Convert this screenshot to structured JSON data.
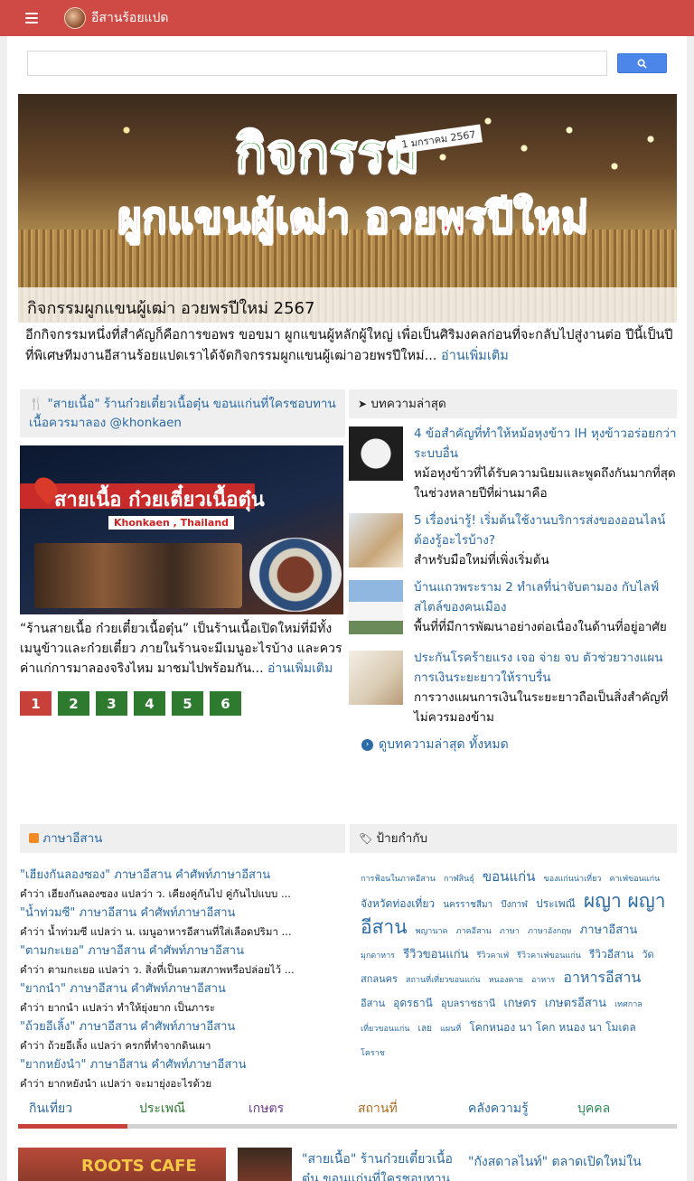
{
  "site": {
    "title": "อีสานร้อยแปด"
  },
  "search": {
    "placeholder": ""
  },
  "hero": {
    "image_text_main": "กิจกรรม",
    "image_text_sub": "ผูกแขนผู้เฒ่า อวยพรปีใหม่",
    "image_date": "1 มกราคม 2567",
    "caption": "กิจกรรมผูกแขนผู้เฒ่า อวยพรปีใหม่ 2567",
    "excerpt": "อีกกิจกรรมหนึ่งที่สำคัญก็คือการขอพร ขอขมา ผูกแขนผู้หลักผู้ใหญ่ เพื่อเป็นศิริมงคลก่อนที่จะกลับไปสู่งานต่อ ปีนี้เป็นปีที่พิเศษทีมงานอีสานร้อยแปดเราได้จัดกิจกรรมผูกแขนผู้เฒ่าอวยพรปีใหม่...",
    "read_more": "อ่านเพิ่มเติม"
  },
  "featured": {
    "title": "\"สายเนื้อ\" ร้านก๋วยเตี๋ยวเนื้อตุ๋น ขอนแก่นที่ใครชอบทานเนื้อควรมาลอง @khonkaen",
    "image_title": "สายเนื้อ ก๋วยเตี๋ยวเนื้อตุ๋น",
    "image_sub": "Khonkaen , Thailand",
    "excerpt": "“ร้านสายเนื้อ ก๋วยเตี๋ยวเนื้อตุ๋น” เป็นร้านเนื้อเปิดใหม่ที่มีทั้งเมนูข้าวและก๋วยเตี๋ยว ภายในร้านจะมีเมนูอะไรบ้าง และควรค่าแก่การมาลองจริงไหม มาชมไปพร้อมกัน...",
    "read_more": "อ่านเพิ่มเติม",
    "pages": [
      "1",
      "2",
      "3",
      "4",
      "5",
      "6"
    ]
  },
  "recent": {
    "header": "บทความล่าสุด",
    "items": [
      {
        "title": "4 ข้อสำคัญที่ทำให้หม้อหุงข้าว IH หุงข้าวอร่อยกว่าระบบอื่น",
        "summary": "หม้อหุงข้าวที่ได้รับความนิยมและพูดถึงกันมากที่สุดในช่วงหลายปีที่ผ่านมาคือ"
      },
      {
        "title": "5 เรื่องน่ารู้! เริ่มต้นใช้งานบริการส่งของออนไลน์ต้องรู้อะไรบ้าง?",
        "summary": "สำหรับมือใหม่ที่เพิ่งเริ่มต้น"
      },
      {
        "title": "บ้านแถวพระราม 2 ทำเลที่น่าจับตามอง กับไลฟ์สไตล์ของคนเมือง",
        "summary": "พื้นที่ที่มีการพัฒนาอย่างต่อเนื่องในด้านที่อยู่อาศัย"
      },
      {
        "title": "ประกันโรคร้ายแรง เจอ จ่าย จบ ตัวช่วยวางแผนการเงินระยะยาวให้ราบรื่น",
        "summary": "การวางแผนการเงินในระยะยาวถือเป็นสิ่งสำคัญที่ไม่ควรมองข้าม"
      }
    ],
    "see_all": "ดูบทความล่าสุด ทั้งหมด"
  },
  "language": {
    "header": "ภาษาอีสาน",
    "items": [
      {
        "title": "\"เฮียงกันลองซอง\" ภาษาอีสาน คำศัพท์ภาษาอีสาน",
        "desc": "คำว่า เฮียงกันลองซอง แปลว่า ว. เคียงคู่กันไป คู่กันไปแบบ ..."
      },
      {
        "title": "\"น้ำท่วมซี\" ภาษาอีสาน คำศัพท์ภาษาอีสาน",
        "desc": "คำว่า น้ำท่วมซี แปลว่า น. เมนูอาหารอีสานที่ใส่เลือดปริมา ..."
      },
      {
        "title": "\"ตามกะเยอ\" ภาษาอีสาน คำศัพท์ภาษาอีสาน",
        "desc": "คำว่า ตามกะเยอ แปลว่า ว. สิ่งที่เป็นตามสภาพหรือปล่อยไว้ ..."
      },
      {
        "title": "\"ยากนำ\" ภาษาอีสาน คำศัพท์ภาษาอีสาน",
        "desc": "คำว่า ยากนำ แปลว่า ทำให้ยุ่งยาก เป็นภาระ"
      },
      {
        "title": "\"ถ้วยอีเลิ้ง\" ภาษาอีสาน คำศัพท์ภาษาอีสาน",
        "desc": "คำว่า ถ้วยอีเลิ้ง แปลว่า ครกที่ทำจากดินเผา"
      },
      {
        "title": "\"ยากหยังนำ\" ภาษาอีสาน คำศัพท์ภาษาอีสาน",
        "desc": "คำว่า ยากหยังนำ แปลว่า จะมายุ่งอะไรด้วย"
      }
    ]
  },
  "tags": {
    "header": "ป้ายกำกับ",
    "items": [
      {
        "label": "การฟ้อนในภาคอีสาน",
        "size": 9
      },
      {
        "label": "กาฬสินธุ์",
        "size": 9
      },
      {
        "label": "ขอนแก่น",
        "size": 15
      },
      {
        "label": "ของแก่นน่าเที่ยว",
        "size": 9
      },
      {
        "label": "คาเฟ่ขอนแก่น",
        "size": 9
      },
      {
        "label": "จังหวัดท่องเที่ยว",
        "size": 12
      },
      {
        "label": "นครราชสีมา",
        "size": 10
      },
      {
        "label": "บึงกาฬ",
        "size": 10
      },
      {
        "label": "ประเพณี",
        "size": 12
      },
      {
        "label": "ผญา ผญาอีสาน",
        "size": 21
      },
      {
        "label": "พญานาค",
        "size": 9
      },
      {
        "label": "ภาคอีสาน",
        "size": 9
      },
      {
        "label": "ภาษา",
        "size": 9
      },
      {
        "label": "ภาษาอังกฤษ",
        "size": 9
      },
      {
        "label": "ภาษาอีสาน",
        "size": 13
      },
      {
        "label": "มุกดาหาร",
        "size": 9
      },
      {
        "label": "รีวิวขอนแก่น",
        "size": 13
      },
      {
        "label": "รีวิวคาเฟ่",
        "size": 9
      },
      {
        "label": "รีวิวคาเฟ่ขอนแก่น",
        "size": 9
      },
      {
        "label": "รีวิวอีสาน",
        "size": 12
      },
      {
        "label": "วัด",
        "size": 11
      },
      {
        "label": "สกลนคร",
        "size": 11
      },
      {
        "label": "สถานที่เที่ยวขอนแก่น",
        "size": 9
      },
      {
        "label": "หนองคาย",
        "size": 9
      },
      {
        "label": "อาหาร",
        "size": 9
      },
      {
        "label": "อาหารอีสาน",
        "size": 16
      },
      {
        "label": "อีสาน",
        "size": 11
      },
      {
        "label": "อุดรธานี",
        "size": 12
      },
      {
        "label": "อุบลราชธานี",
        "size": 11
      },
      {
        "label": "เกษตร",
        "size": 13
      },
      {
        "label": "เกษตรอีสาน",
        "size": 13
      },
      {
        "label": "เทศกาล",
        "size": 9
      },
      {
        "label": "เที่ยวขอนแก่น",
        "size": 9
      },
      {
        "label": "เลย",
        "size": 10
      },
      {
        "label": "แผนที่",
        "size": 9
      },
      {
        "label": "โคกหนอง นา โคก หนอง นา โมเดล",
        "size": 12
      },
      {
        "label": "โคราช",
        "size": 9
      }
    ]
  },
  "tabs": [
    {
      "label": "กินเที่ยว",
      "color": "#2a6aa6"
    },
    {
      "label": "ประเพณี",
      "color": "#2e7a2e"
    },
    {
      "label": "เกษตร",
      "color": "#6a3a8a"
    },
    {
      "label": "สถานที่",
      "color": "#b06a1a"
    },
    {
      "label": "คลังความรู้",
      "color": "#2a6aa6"
    },
    {
      "label": "บุคคล",
      "color": "#2e8a5a"
    }
  ],
  "bottom_cards": {
    "card1_image_text": "ROOTS CAFE",
    "card2_title": "\"สายเนื้อ\" ร้านก๋วยเตี๋ยวเนื้อตุ๋น ขอนแก่นที่ใครชอบทาน",
    "card3_title": "\"กังสดาลไนท์\" ตลาดเปิดใหม่ใน"
  },
  "colors": {
    "topbar": "#cf4a44",
    "link": "#2a6aa6",
    "pager": "#2e7a2e",
    "pager_active": "#c8403a"
  }
}
